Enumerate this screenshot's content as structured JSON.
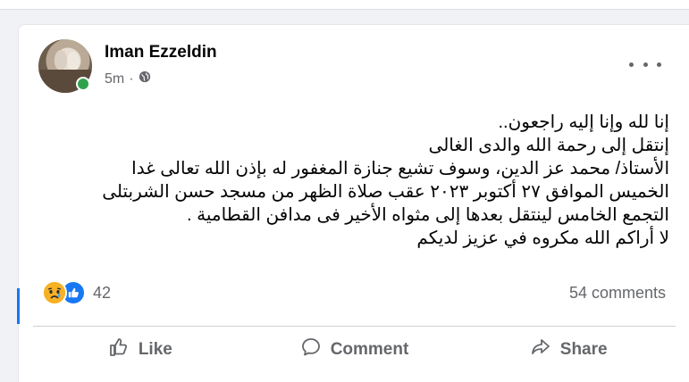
{
  "post": {
    "author": "Iman Ezzeldin",
    "timestamp": "5m",
    "separator": "·",
    "privacy_icon": "globe-icon",
    "options_icon": "more-horizontal-icon",
    "lines": [
      "إنا لله وإنا إليه راجعون..",
      "إنتقل إلى رحمة الله والدى الغالى",
      "الأستاذ/ محمد عز الدين، وسوف تشيع جنازة المغفور له بإذن الله تعالى غدا",
      "الخميس الموافق ٢٧ أكتوبر ٢٠٢٣ عقب صلاة الظهر من مسجد حسن الشربتلى",
      "التجمع الخامس لينتقل بعدها إلى مثواه الأخير فى مدافن القطامية .",
      "لا أراكم الله مكروه في عزيز لديكم"
    ]
  },
  "reactions": {
    "icons": [
      "sad-emoji-icon",
      "like-icon"
    ],
    "count": "42",
    "comments": "54 comments"
  },
  "actions": {
    "like": "Like",
    "comment": "Comment",
    "share": "Share"
  },
  "colors": {
    "accent": "#1877f2",
    "online": "#31a24c",
    "secondary_text": "#65676b"
  }
}
